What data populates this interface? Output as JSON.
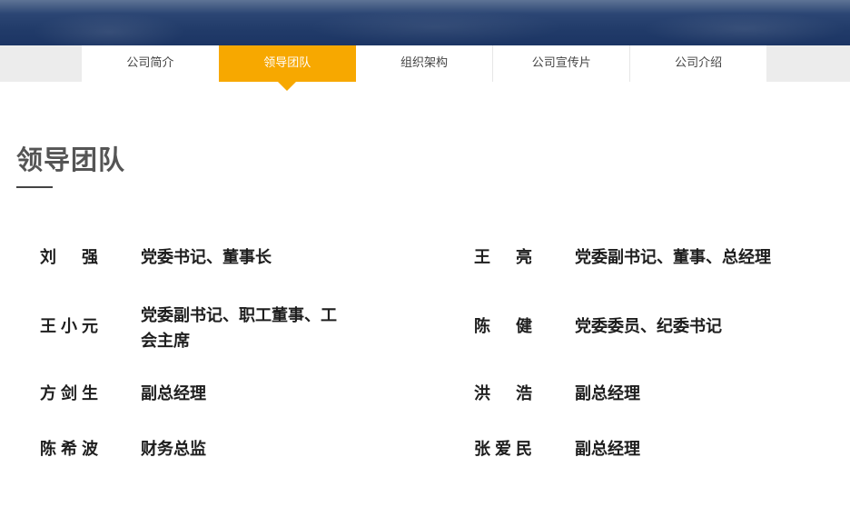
{
  "nav": {
    "tabs": [
      {
        "label": "公司简介",
        "active": false
      },
      {
        "label": "领导团队",
        "active": true
      },
      {
        "label": "组织架构",
        "active": false
      },
      {
        "label": "公司宣传片",
        "active": false
      },
      {
        "label": "公司介绍",
        "active": false
      }
    ],
    "active_color": "#f7a800"
  },
  "section": {
    "title": "领导团队"
  },
  "leaders": [
    {
      "name": "刘强",
      "title": "党委书记、董事长"
    },
    {
      "name": "王亮",
      "title": "党委副书记、董事、总经理"
    },
    {
      "name": "王小元",
      "title": "党委副书记、职工董事、工会主席"
    },
    {
      "name": "陈健",
      "title": "党委委员、纪委书记"
    },
    {
      "name": "方剑生",
      "title": "副总经理"
    },
    {
      "name": "洪浩",
      "title": "副总经理"
    },
    {
      "name": "陈希波",
      "title": "财务总监"
    },
    {
      "name": "张爱民",
      "title": "副总经理"
    }
  ]
}
